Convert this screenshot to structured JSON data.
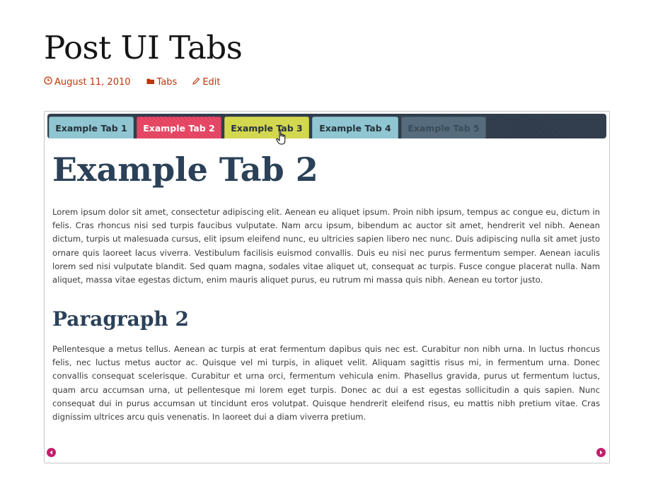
{
  "post": {
    "title": "Post UI Tabs",
    "meta": {
      "date": "August 11, 2010",
      "category": "Tabs",
      "edit_label": "Edit"
    }
  },
  "tabs": {
    "items": [
      {
        "label": "Example Tab 1"
      },
      {
        "label": "Example Tab 2"
      },
      {
        "label": "Example Tab 3"
      },
      {
        "label": "Example Tab 4"
      },
      {
        "label": "Example Tab 5"
      }
    ],
    "active_index": 1,
    "colors": {
      "tab_bar": "#2e3a4a",
      "tab_1": "#8fc6d1",
      "tab_2": "#e3415f",
      "tab_3": "#d2d64a",
      "tab_4": "#8fc6d1",
      "tab_5": "#566c7c",
      "nav_arrow": "#c31f6e",
      "meta_link": "#bc360a"
    }
  },
  "content": {
    "heading": "Example Tab 2",
    "paragraph_1": "Lorem ipsum dolor sit amet, consectetur adipiscing elit. Aenean eu aliquet ipsum. Proin nibh ipsum, tempus ac congue eu, dictum in felis. Cras rhoncus nisi sed turpis faucibus vulputate. Nam arcu ipsum, bibendum ac auctor sit amet, hendrerit vel nibh. Aenean dictum, turpis ut malesuada cursus, elit ipsum eleifend nunc, eu ultricies sapien libero nec nunc. Duis adipiscing nulla sit amet justo ornare quis laoreet lacus viverra. Vestibulum facilisis euismod convallis. Duis eu nisi nec purus fermentum semper. Aenean iaculis lorem sed nisi vulputate blandit. Sed quam magna, sodales vitae aliquet ut, consequat ac turpis. Fusce congue placerat nulla. Nam aliquet, massa vitae egestas dictum, enim mauris aliquet purus, eu rutrum mi massa quis nibh. Aenean eu tortor justo.",
    "subheading": "Paragraph 2",
    "paragraph_2": "Pellentesque a metus tellus. Aenean ac turpis at erat fermentum dapibus quis nec est. Curabitur non nibh urna. In luctus rhoncus felis, nec luctus metus auctor ac. Quisque vel mi turpis, in aliquet velit. Aliquam sagittis risus mi, in fermentum urna. Donec convallis consequat scelerisque. Curabitur et urna orci, fermentum vehicula enim. Phasellus gravida, purus ut fermentum luctus, quam arcu accumsan urna, ut pellentesque mi lorem eget turpis. Donec ac dui a est egestas sollicitudin a quis sapien. Nunc consequat dui in purus accumsan ut tincidunt eros volutpat. Quisque hendrerit eleifend risus, eu mattis nibh pretium vitae. Cras dignissim ultrices arcu quis venenatis. In laoreet dui a diam viverra pretium."
  },
  "icons": {
    "date": "clock-icon",
    "category": "folder-icon",
    "edit": "pencil-icon",
    "prev": "chevron-left-icon",
    "next": "chevron-right-icon",
    "cursor": "hand-pointer-icon"
  }
}
